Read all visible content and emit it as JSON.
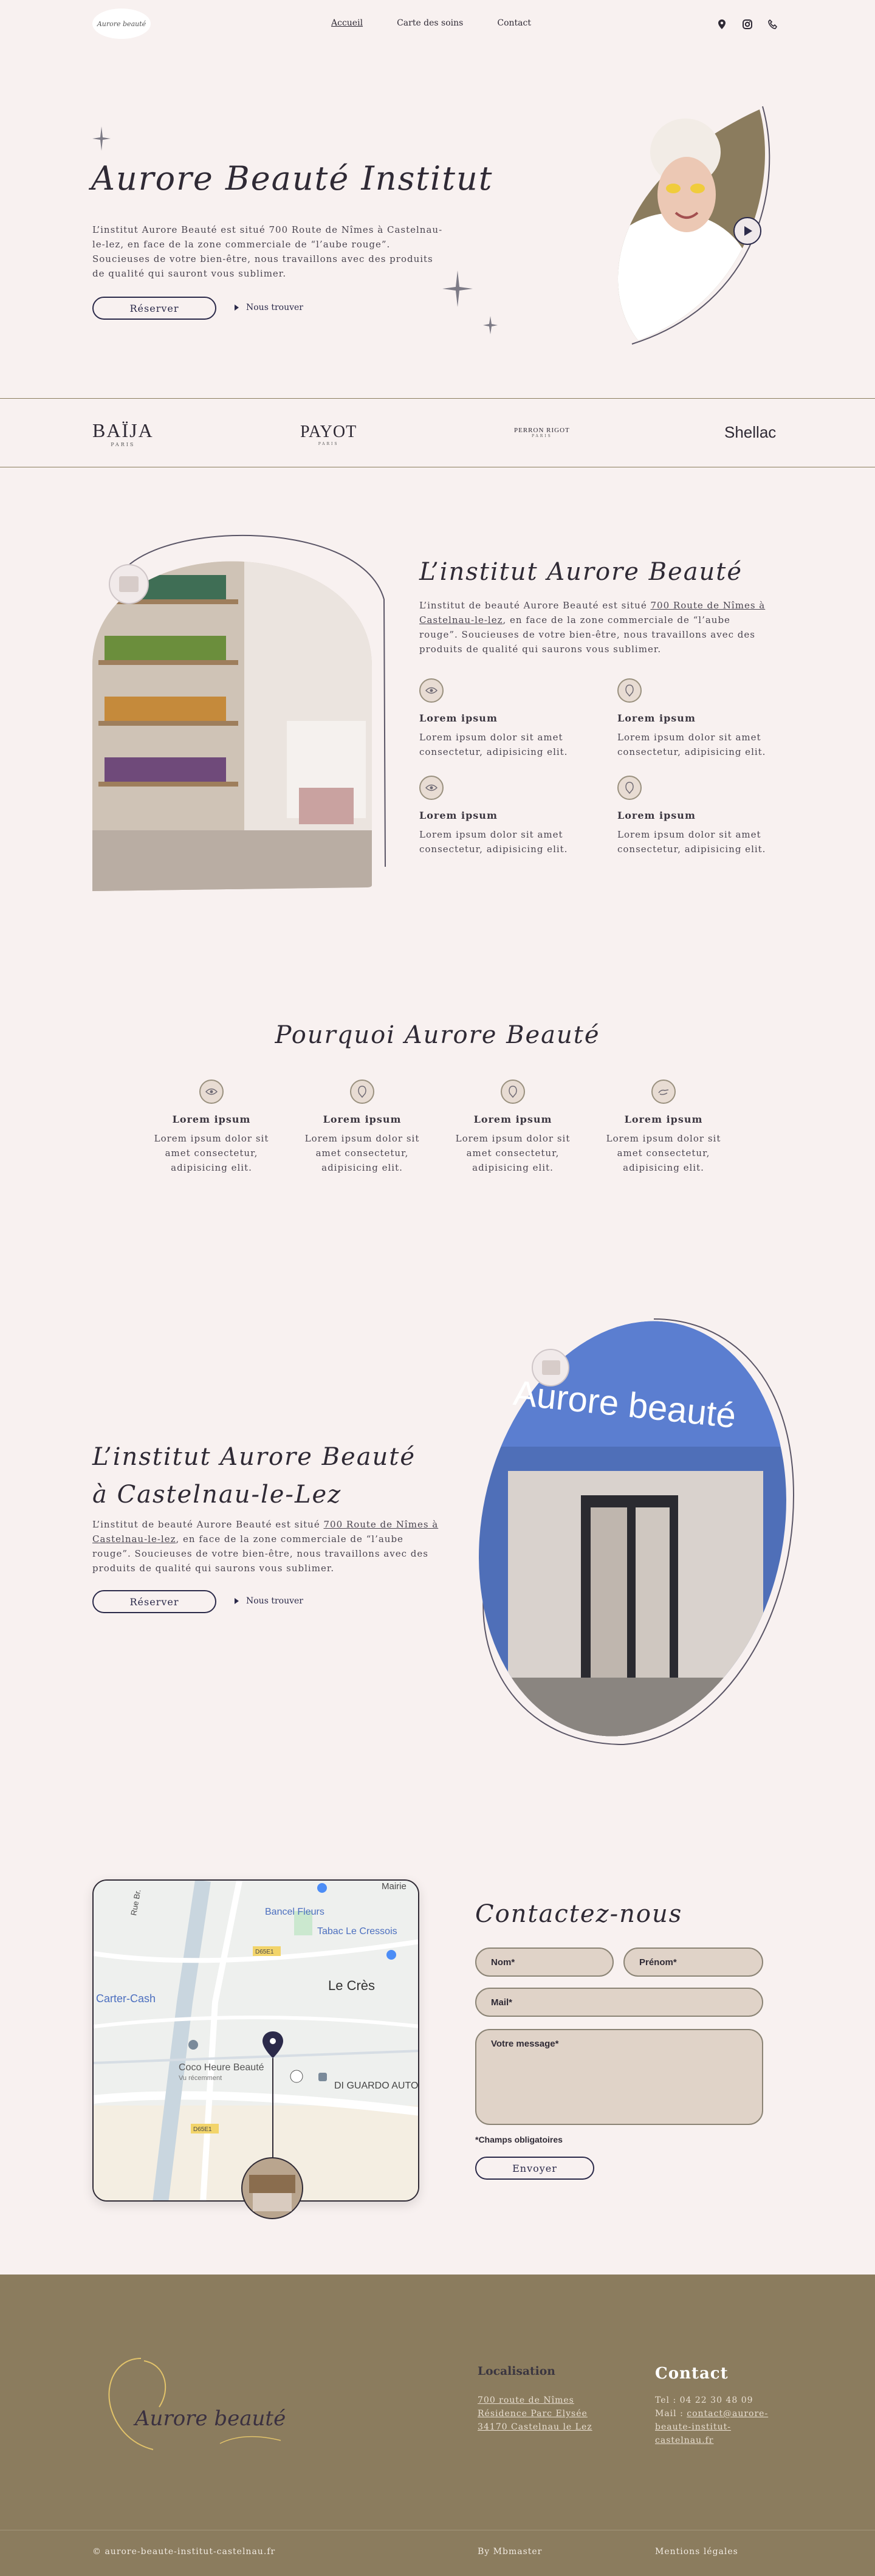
{
  "header": {
    "logo_text": "Aurore beauté",
    "nav": [
      "Accueil",
      "Carte des soins",
      "Contact"
    ],
    "icons": [
      "location-icon",
      "instagram-icon",
      "phone-icon"
    ]
  },
  "hero": {
    "title": "Aurore Beauté Institut",
    "text": "L’institut Aurore Beauté est situé 700 Route de Nîmes à Castelnau-le-lez, en face de la zone commerciale de “l’aube rouge”. Soucieuses de votre bien-être, nous travaillons avec des produits de qualité qui sauront vous sublimer.",
    "reserve_label": "Réserver",
    "find_label": "Nous trouver"
  },
  "brands": [
    "BAÏJA",
    "PAYOT",
    "PERRON RIGOT",
    "Shellac"
  ],
  "brand_subs": [
    "PARIS",
    "PARIS",
    "PARIS",
    ""
  ],
  "institut": {
    "title": "L’institut Aurore Beauté",
    "text_before": "L’institut de beauté Aurore Beauté est situé ",
    "text_link": "700 Route de Nîmes à Castelnau-le-lez",
    "text_after": ", en face de la zone commerciale de “l’aube rouge”. Soucieuses  de votre bien-être, nous travaillons avec des produits de qualité qui  saurons vous sublimer.",
    "features": [
      {
        "title": "Lorem ipsum",
        "text": "Lorem ipsum dolor sit amet consectetur, adipisicing elit.",
        "icon": "eye-icon"
      },
      {
        "title": "Lorem ipsum",
        "text": "Lorem ipsum dolor sit amet consectetur, adipisicing elit.",
        "icon": "face-icon"
      },
      {
        "title": "Lorem ipsum",
        "text": "Lorem ipsum dolor sit amet consectetur, adipisicing elit.",
        "icon": "eye-icon"
      },
      {
        "title": "Lorem ipsum",
        "text": "Lorem ipsum dolor sit amet consectetur, adipisicing elit.",
        "icon": "face-icon"
      }
    ]
  },
  "why": {
    "title": "Pourquoi Aurore Beauté",
    "items": [
      {
        "title": "Lorem ipsum",
        "text": "Lorem ipsum dolor sit amet consectetur, adipisicing elit.",
        "icon": "eye-icon"
      },
      {
        "title": "Lorem ipsum",
        "text": "Lorem ipsum dolor sit amet consectetur, adipisicing elit.",
        "icon": "face-icon"
      },
      {
        "title": "Lorem ipsum",
        "text": "Lorem ipsum dolor sit amet consectetur, adipisicing elit.",
        "icon": "face-icon"
      },
      {
        "title": "Lorem ipsum",
        "text": "Lorem ipsum dolor sit amet consectetur, adipisicing elit.",
        "icon": "hand-icon"
      }
    ]
  },
  "castelnau": {
    "title_line1": "L’institut Aurore Beauté",
    "title_line2": "à Castelnau-le-Lez",
    "text_before": "L’institut de beauté Aurore Beauté est situé ",
    "text_link": "700 Route de Nîmes à Castelnau-le-lez",
    "text_after": ", en face de la zone commerciale de “l’aube rouge”. Soucieuses  de votre bien-être, nous travaillons avec des produits de qualité qui  saurons vous sublimer.",
    "reserve_label": "Réserver",
    "find_label": "Nous trouver",
    "storefront_sign": "Aurore beauté"
  },
  "map": {
    "labels": [
      "Rue Br.",
      "Mairie",
      "Bancel Fleurs",
      "Tabac Le Cressois",
      "D65E1",
      "Carter-Cash",
      "Le Crès",
      "Coco Heure Beauté",
      "Vu récemment",
      "DI GUARDO AUTOMOBILES",
      "D65E1"
    ]
  },
  "contact": {
    "title": "Contactez-nous",
    "nom": "Nom*",
    "prenom": "Prénom*",
    "mail": "Mail*",
    "message": "Votre message*",
    "required": "*Champs obligatoires",
    "send": "Envoyer"
  },
  "footer": {
    "logo_text": "Aurore beauté",
    "loc_title": "Localisation",
    "loc_lines": [
      "700 route de Nîmes",
      "Résidence Parc Elysée",
      "34170 Castelnau le Lez"
    ],
    "contact_title": "Contact",
    "tel": "Tel : 04 22 30 48 09",
    "mail_prefix": "Mail : ",
    "mail_lines": [
      "contact@aurore-",
      "beaute-institut-",
      "castelnau.fr"
    ],
    "copyright": "© aurore-beaute-institut-castelnau.fr",
    "by": "By Mbmaster",
    "legal": "Mentions légales"
  },
  "colors": {
    "background": "#f8f1f0",
    "gold": "#8b7c5e",
    "navy": "#2b2a4a",
    "field": "#e0d3c8"
  }
}
